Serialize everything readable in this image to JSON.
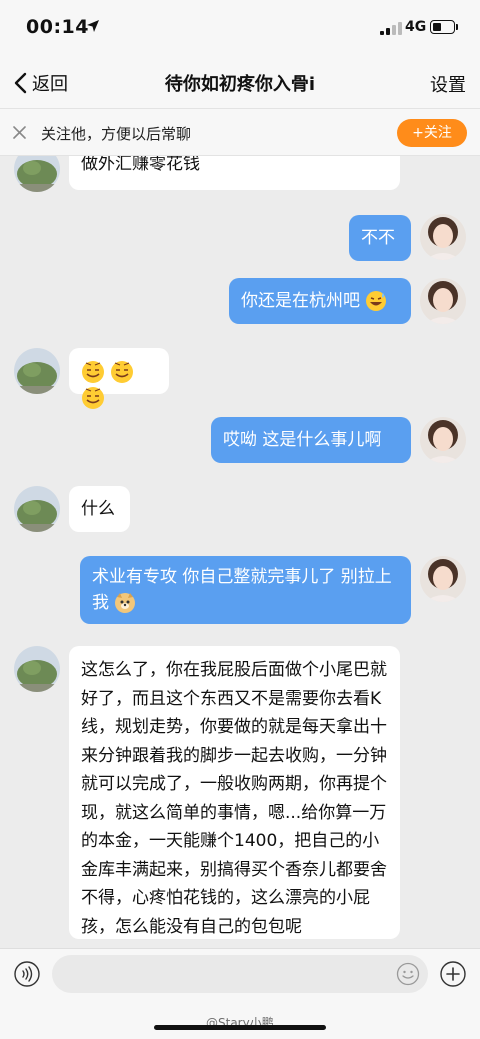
{
  "status_bar": {
    "time": "00:14",
    "network": "4G"
  },
  "nav": {
    "back_label": "返回",
    "title": "待你如初疼你入骨i",
    "settings_label": "设置"
  },
  "follow_bar": {
    "text": "关注他，方便以后常聊",
    "button_label": "+关注"
  },
  "partial_text": "做外汇赚零花钱",
  "messages": [
    {
      "side": "out",
      "text": "不不"
    },
    {
      "side": "out",
      "text": "你还是在杭州吧",
      "emoji": "grin-sweat"
    },
    {
      "side": "in",
      "emoji": [
        "sweat-smile",
        "sweat-smile",
        "sweat-smile"
      ]
    },
    {
      "side": "out",
      "text": "哎呦 这是什么事儿啊"
    },
    {
      "side": "in",
      "text": "什么"
    },
    {
      "side": "out",
      "text": "术业有专攻 你自己整就完事儿了 别拉上我",
      "emoji": "doge"
    },
    {
      "side": "in",
      "text": "这怎么了，你在我屁股后面做个小尾巴就好了，而且这个东西又不是需要你去看K线，规划走势，你要做的就是每天拿出十来分钟跟着我的脚步一起去收购，一分钟就可以完成了，一般收购两期，你再提个现，就这么简单的事情，嗯...给你算一万的本金，一天能赚个1400，把自己的小金库丰满起来，别搞得买个香奈儿都要舍不得，心疼怕花钱的，这么漂亮的小屁孩，怎么能没有自己的包包呢"
    }
  ],
  "input": {
    "placeholder": ""
  },
  "watermark": "@Stary小鹏",
  "colors": {
    "out_bubble": "#5a9ff0",
    "follow_button": "#ff8c1a"
  }
}
